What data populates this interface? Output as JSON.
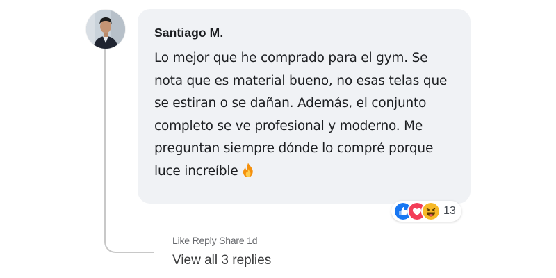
{
  "comment": {
    "author": "Santiago M.",
    "text": "Lo mejor que he comprado para el gym. Se nota que es material bueno, no esas telas que se estiran o se dañan. Además, el conjunto completo se ve profesional y moderno. Me preguntan siempre dónde lo compré porque luce increíble",
    "trailing_emoji": "fire-emoji"
  },
  "reactions": {
    "icons": [
      "like-icon",
      "love-icon",
      "haha-icon"
    ],
    "count": "13",
    "colors": {
      "like": "#1877f2",
      "love": "#f33e58",
      "haha": "#f7b928"
    }
  },
  "actions": {
    "like": "Like",
    "reply": "Reply",
    "share": "Share",
    "time": "1d"
  },
  "view_replies": "View all 3 replies",
  "colors": {
    "bubble_bg": "#f0f2f5",
    "text": "#1c1e21",
    "muted": "#65676b",
    "thread_line": "#c8c8c8"
  }
}
